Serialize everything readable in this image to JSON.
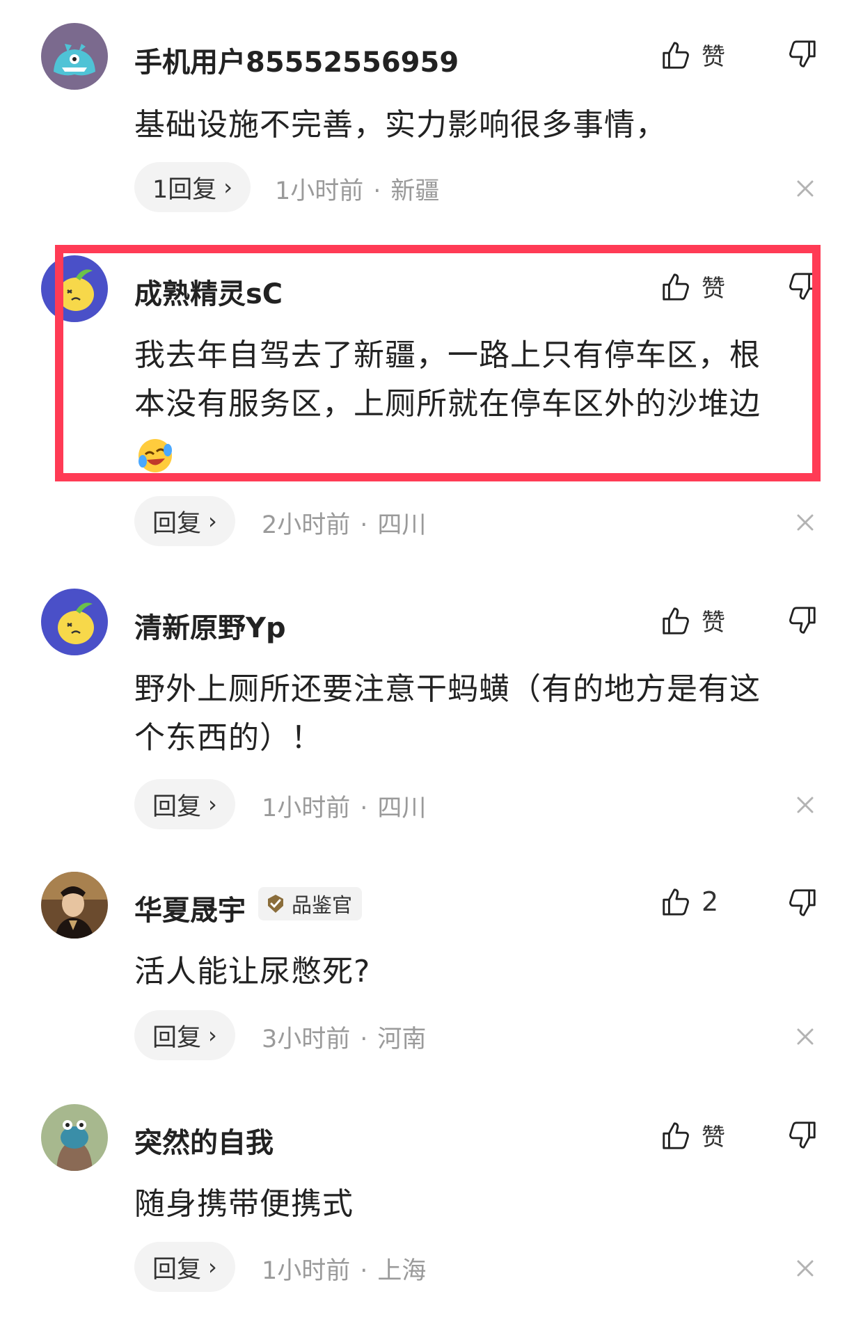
{
  "comments": [
    {
      "username": "手机用户85552556959",
      "text": "基础设施不完善，实力影响很多事情，",
      "reply_label": "1回复",
      "time": "1小时前",
      "location": "新疆",
      "like_label": "赞"
    },
    {
      "username": "成熟精灵sC",
      "text_line1": "我去年自驾去了新疆，一路上只有停车区，根",
      "text_line2": "本没有服务区，上厕所就在停车区外的沙堆边",
      "emoji": "laughing-crying-emoji",
      "reply_label": "回复",
      "time": "2小时前",
      "location": "四川",
      "like_label": "赞",
      "highlighted": true,
      "highlight_color": "#ff3b55"
    },
    {
      "username": "清新原野Yp",
      "text_line1": "野外上厕所还要注意干蚂蟥（有的地方是有这",
      "text_line2": "个东西的）！",
      "reply_label": "回复",
      "time": "1小时前",
      "location": "四川",
      "like_label": "赞"
    },
    {
      "username": "华夏晟宇",
      "badge": "品鉴官",
      "text": "活人能让尿憋死?",
      "reply_label": "回复",
      "time": "3小时前",
      "location": "河南",
      "like_label": "2"
    },
    {
      "username": "突然的自我",
      "text": "随身携带便携式",
      "reply_label": "回复",
      "time": "1小时前",
      "location": "上海",
      "like_label": "赞"
    }
  ],
  "separator": "·",
  "icons": {
    "like": "thumbs-up-icon",
    "dislike": "thumbs-down-icon",
    "chevron": "chevron-right-icon",
    "close": "close-icon"
  }
}
